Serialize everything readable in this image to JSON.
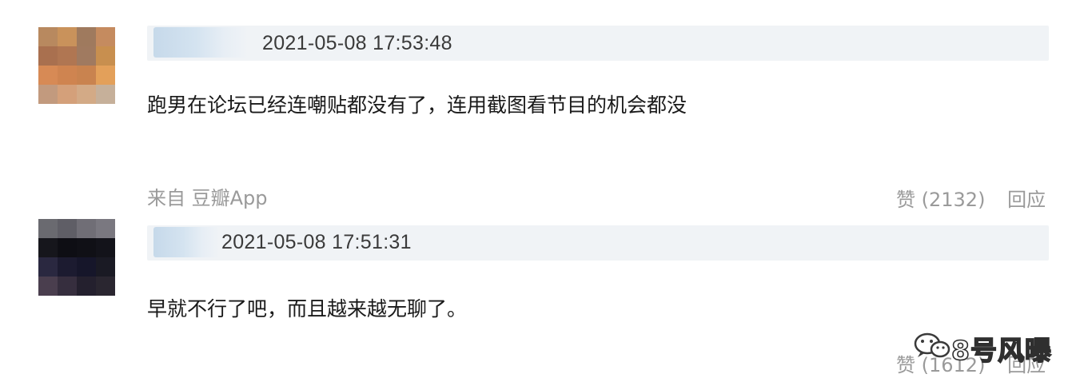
{
  "comments": [
    {
      "timestamp": "2021-05-08 17:53:48",
      "text": "跑男在论坛已经连嘲贴都没有了，连用截图看节目的机会都没",
      "source": "来自 豆瓣App",
      "like_label": "赞 (2132)",
      "reply_label": "回应",
      "avatar_colors": [
        "#b8895f",
        "#c9925b",
        "#9f7a5e",
        "#c58b5f",
        "#a9704f",
        "#b07652",
        "#a07a60",
        "#c88f4f",
        "#d78a55",
        "#cf8450",
        "#c9834f",
        "#e3a05a",
        "#c29a7e",
        "#d4a07a",
        "#d3aa86",
        "#c6b09a"
      ]
    },
    {
      "timestamp": "2021-05-08 17:51:31",
      "text": "早就不行了吧，而且越来越无聊了。",
      "like_label": "赞 (1612)",
      "reply_label": "回应",
      "avatar_colors": [
        "#6a6a70",
        "#5f5e66",
        "#706e76",
        "#7a7880",
        "#16161c",
        "#0e0e14",
        "#101016",
        "#13131a",
        "#2a2840",
        "#1c1b30",
        "#16162a",
        "#1a1a24",
        "#4a3e4e",
        "#362e3e",
        "#24202e",
        "#2a2630"
      ]
    }
  ],
  "watermark": {
    "text": "8号风曝"
  }
}
